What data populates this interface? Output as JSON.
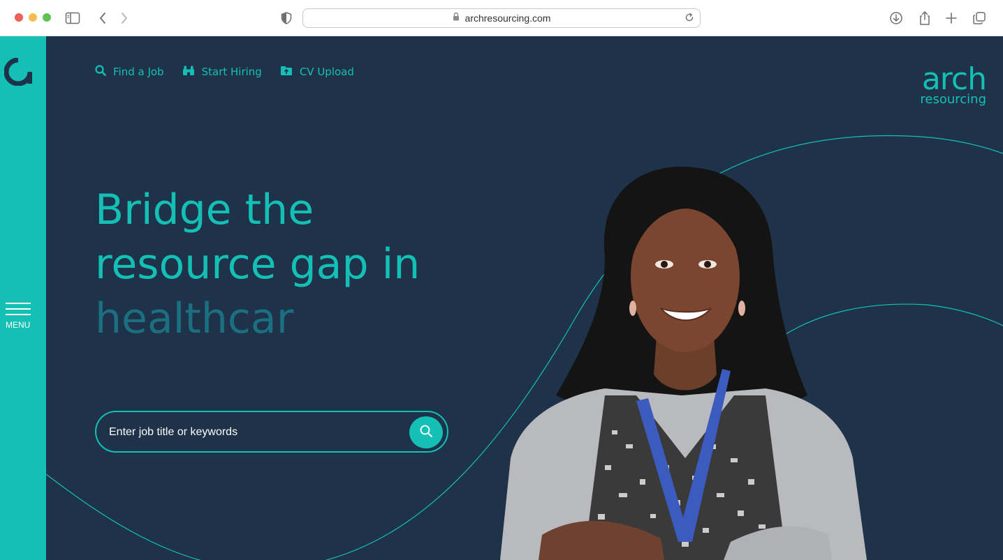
{
  "browser": {
    "url": "archresourcing.com"
  },
  "sidebar": {
    "logo_icon": "arch-a-logo-icon",
    "menu_label": "MENU"
  },
  "nav": {
    "items": [
      {
        "label": "Find a Job",
        "icon": "search-icon"
      },
      {
        "label": "Start Hiring",
        "icon": "binoculars-icon"
      },
      {
        "label": "CV Upload",
        "icon": "folder-upload-icon"
      }
    ]
  },
  "brand": {
    "line1": "arch",
    "line2": "resourcing"
  },
  "hero": {
    "headline_line1": "Bridge the",
    "headline_line2": "resource gap in",
    "headline_typed": "healthcar"
  },
  "search": {
    "placeholder": "Enter job title or keywords"
  },
  "colors": {
    "accent": "#14c0b5",
    "background": "#1e3249",
    "typed_text": "#1b6f80"
  }
}
